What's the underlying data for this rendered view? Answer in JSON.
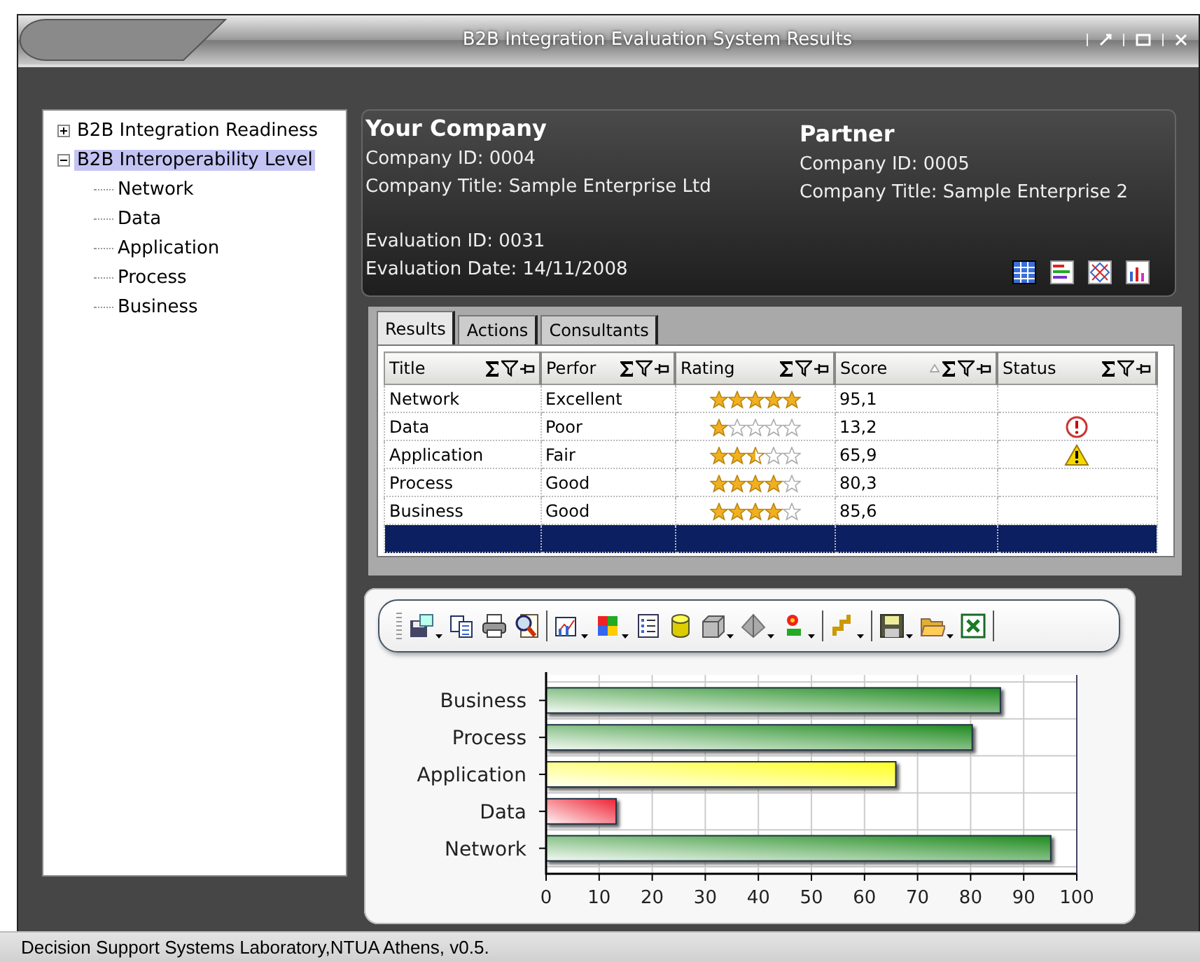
{
  "window": {
    "title": "B2B Integration Evaluation System Results"
  },
  "tree": [
    {
      "label": "B2B Integration Readiness",
      "expanded": false,
      "selected": false
    },
    {
      "label": "B2B Interoperability Level",
      "expanded": true,
      "selected": true,
      "children": [
        {
          "label": "Network",
          "selected": false
        },
        {
          "label": "Data",
          "selected": false
        },
        {
          "label": "Application",
          "selected": false
        },
        {
          "label": "Process",
          "selected": false
        },
        {
          "label": "Business",
          "selected": false
        }
      ]
    }
  ],
  "your_company": {
    "heading": "Your Company",
    "company_id": "Company ID: 0004",
    "company_title": "Company Title: Sample Enterprise Ltd",
    "evaluation_id": "Evaluation ID: 0031",
    "evaluation_date": "Evaluation Date: 14/11/2008"
  },
  "partner": {
    "heading": "Partner",
    "company_id": "Company ID: 0005",
    "company_title": "Company Title: Sample Enterprise 2"
  },
  "tabs": [
    {
      "label": "Results",
      "selected": true
    },
    {
      "label": "Actions",
      "selected": false
    },
    {
      "label": "Consultants",
      "selected": false
    }
  ],
  "table": {
    "columns": [
      {
        "label": "Title",
        "sorted": false
      },
      {
        "label": "Perfor",
        "sorted": false
      },
      {
        "label": "Rating",
        "sorted": false
      },
      {
        "label": "Score",
        "sorted": true
      },
      {
        "label": "Status",
        "sorted": false
      }
    ],
    "rows": [
      {
        "title": "Network",
        "performance": "Excellent",
        "stars": 5,
        "score": "95,1",
        "error": false,
        "warning": false
      },
      {
        "title": "Data",
        "performance": "Poor",
        "stars": 1,
        "score": "13,2",
        "error": true,
        "warning": false
      },
      {
        "title": "Application",
        "performance": "Fair",
        "stars": 2.5,
        "score": "65,9",
        "error": false,
        "warning": true
      },
      {
        "title": "Process",
        "performance": "Good",
        "stars": 4,
        "score": "80,3",
        "error": false,
        "warning": false
      },
      {
        "title": "Business",
        "performance": "Good",
        "stars": 4,
        "score": "85,6",
        "error": false,
        "warning": false
      }
    ],
    "new_row_selected": true
  },
  "chart_data": {
    "type": "bar",
    "orientation": "horizontal",
    "grid": true,
    "categories": [
      "Business",
      "Process",
      "Application",
      "Data",
      "Network"
    ],
    "series": [
      {
        "color": "#1e8a1e",
        "values": [
          85.6,
          80.3,
          null,
          null,
          95.1
        ]
      },
      {
        "color": "#ffff22",
        "values": [
          null,
          null,
          65.9,
          null,
          null
        ]
      },
      {
        "color": "#ee2233",
        "values": [
          null,
          null,
          null,
          13.2,
          null
        ]
      }
    ],
    "xlim": [
      0,
      100
    ],
    "xticks": [
      0,
      10,
      20,
      30,
      40,
      50,
      60,
      70,
      80,
      90,
      100
    ]
  },
  "status_bar": {
    "text": "Decision Support Systems Laboratory,NTUA Athens, v0.5."
  }
}
